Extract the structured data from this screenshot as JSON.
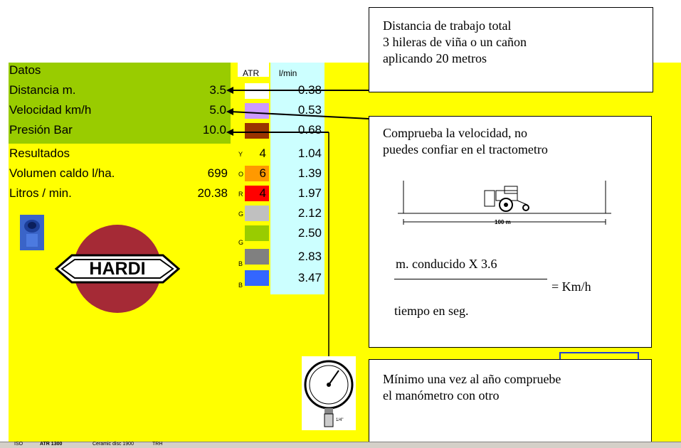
{
  "sheet": {
    "section_datos": "Datos",
    "rows_input": [
      {
        "label": "Distancia m.",
        "value": "3.5"
      },
      {
        "label": "Velocidad  km/h",
        "value": "5.0"
      },
      {
        "label": "Presión Bar",
        "value": "10.0"
      }
    ],
    "section_resultados": "Resultados",
    "rows_output": [
      {
        "label": "Volumen caldo l/ha.",
        "value": "699"
      },
      {
        "label": "Litros / min.",
        "value": "20.38"
      }
    ]
  },
  "nozzle_table": {
    "header_atr": "ATR",
    "header_lmin": "l/min",
    "rows": [
      {
        "code": "",
        "atr": "",
        "color": "#ffffff",
        "flow": "0.38"
      },
      {
        "code": "",
        "atr": "",
        "color": "#cc99ff",
        "flow": "0.53"
      },
      {
        "code": "",
        "atr": "",
        "color": "#993300",
        "flow": "0.68"
      },
      {
        "code": "Y",
        "atr": "4",
        "color": "#ffff00",
        "flow": "1.04"
      },
      {
        "code": "O",
        "atr": "6",
        "color": "#ff9900",
        "flow": "1.39"
      },
      {
        "code": "R",
        "atr": "4",
        "color": "#ff0000",
        "flow": "1.97"
      },
      {
        "code": "G",
        "atr": "",
        "color": "#c0c0c0",
        "flow": "2.12"
      },
      {
        "code": "G",
        "atr": "",
        "color": "#99cc00",
        "flow": "2.50"
      },
      {
        "code": "B",
        "atr": "",
        "color": "#808080",
        "flow": "2.83"
      },
      {
        "code": "B",
        "atr": "",
        "color": "#3366ff",
        "flow": "3.47"
      }
    ]
  },
  "logo": {
    "text": "HARDI",
    "circle_color": "#a52a36"
  },
  "callouts": {
    "distance": {
      "lines": [
        "Distancia de trabajo total",
        "3 hileras de viña o un cañon",
        "aplicando 20 metros"
      ]
    },
    "speed": {
      "lines": [
        "Comprueba la velocidad, no",
        "puedes confiar en el tractometro"
      ],
      "figure_label": "100 m",
      "formula_numerator": "m.  conducido X 3.6",
      "formula_result": "= Km/h",
      "formula_denominator": "tiempo en seg."
    },
    "gauge": {
      "lines": [
        "Mínimo una vez al año compruebe",
        "el manómetro con otro"
      ]
    }
  },
  "gauge_icon": {
    "label": "1/4\""
  },
  "tabs": [
    "ISO",
    "ATR 1300",
    "Ceramic disc 1900",
    "TRH"
  ]
}
